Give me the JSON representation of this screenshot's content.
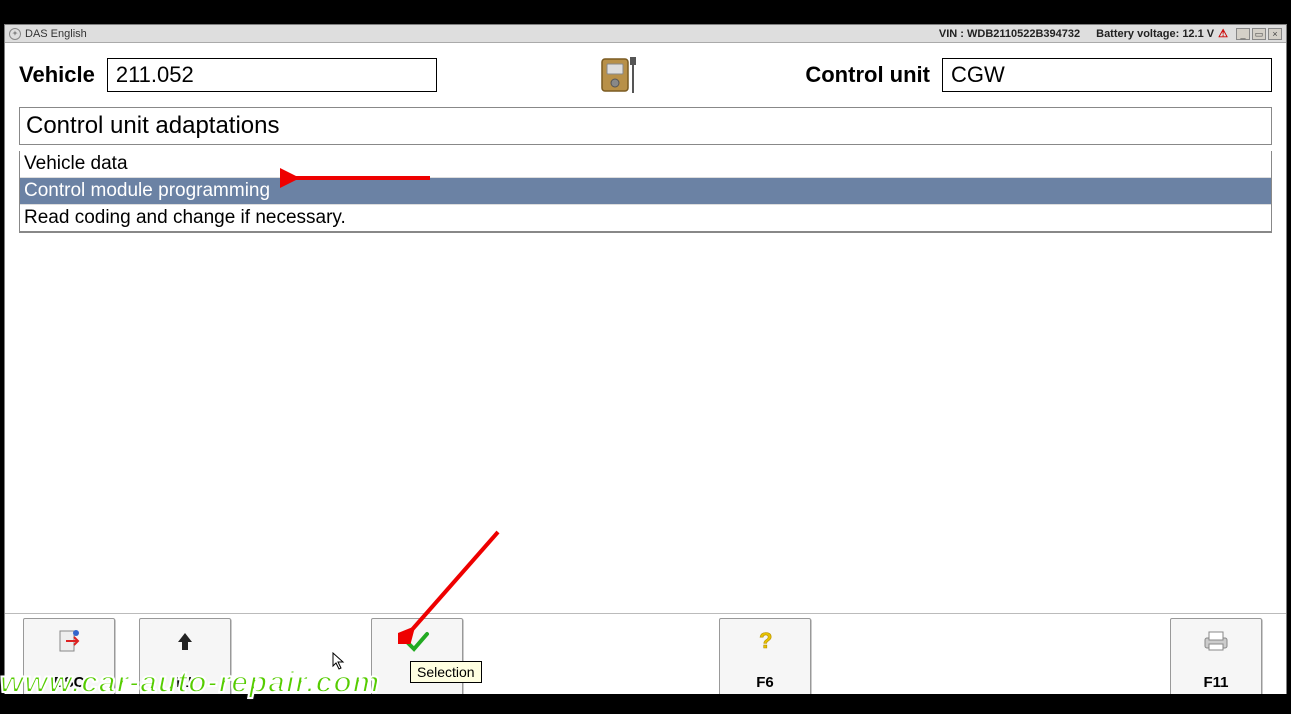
{
  "titlebar": {
    "app_name": "DAS English",
    "vin_label": "VIN : WDB2110522B394732",
    "battery_label": "Battery voltage: 12.1 V"
  },
  "header": {
    "vehicle_label": "Vehicle",
    "vehicle_value": "211.052",
    "control_unit_label": "Control unit",
    "control_unit_value": "CGW"
  },
  "page_title": "Control unit adaptations",
  "list": {
    "item0": "Vehicle data",
    "item1": "Control module programming",
    "item2": "Read coding and change if necessary."
  },
  "fkeys": {
    "esc": "ESC",
    "f1": "F1",
    "f3": "",
    "f3_tooltip": "Selection",
    "f6": "F6",
    "f11": "F11"
  },
  "watermark": "www.car-auto-repair.com"
}
